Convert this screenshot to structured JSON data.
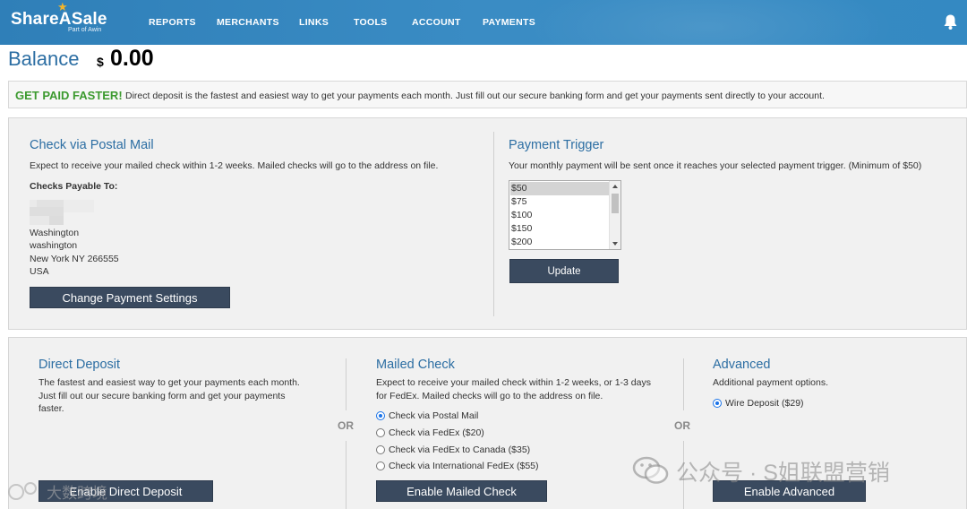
{
  "brand": {
    "name": "ShareASale",
    "sub": "Part of Awin",
    "star_color": "#f2b42b"
  },
  "nav": {
    "items": [
      "REPORTS",
      "MERCHANTS",
      "LINKS",
      "TOOLS",
      "ACCOUNT",
      "PAYMENTS"
    ],
    "bell_icon": "bell-icon"
  },
  "balance": {
    "label": "Balance",
    "currency": "$",
    "amount": "0.00"
  },
  "banner": {
    "strong": "GET PAID FASTER!",
    "text": "Direct deposit is the fastest and easiest way to get your payments each month. Just fill out our secure banking form and get your payments sent directly to your account.",
    "accent": "#3c9a2f"
  },
  "postal": {
    "title": "Check via Postal Mail",
    "description": "Expect to receive your mailed check within 1-2 weeks. Mailed checks will go to the address on file.",
    "payable_label": "Checks Payable To:",
    "address": [
      "Washington",
      "washington",
      "New York NY 266555",
      "USA"
    ],
    "button": "Change Payment Settings"
  },
  "trigger": {
    "title": "Payment Trigger",
    "description": "Your monthly payment will be sent once it reaches your selected payment trigger. (Minimum of $50)",
    "options": [
      "$50",
      "$75",
      "$100",
      "$150",
      "$200"
    ],
    "selected": "$50",
    "button": "Update"
  },
  "methods": {
    "or_label": "OR",
    "direct": {
      "title": "Direct Deposit",
      "description": "The fastest and easiest way to get your payments each month. Just fill out our secure banking form and get your payments faster.",
      "button": "Enable Direct Deposit"
    },
    "mailed": {
      "title": "Mailed Check",
      "description": "Expect to receive your mailed check within 1-2 weeks, or 1-3 days for FedEx. Mailed checks will go to the address on file.",
      "options": [
        "Check via Postal Mail",
        "Check via FedEx ($20)",
        "Check via FedEx to Canada ($35)",
        "Check via International FedEx ($55)"
      ],
      "selected": "Check via Postal Mail",
      "button": "Enable Mailed Check"
    },
    "advanced": {
      "title": "Advanced",
      "description": "Additional payment options.",
      "options": [
        "Wire Deposit ($29)"
      ],
      "selected": "Wire Deposit ($29)",
      "button": "Enable Advanced"
    }
  },
  "watermarks": {
    "right": "公众号 · S姐联盟营销",
    "left": "大数跨境"
  },
  "colors": {
    "header": "#3489c2",
    "title_blue": "#2c6ea3",
    "button": "#3a4a5f",
    "panel": "#f1f1f1"
  }
}
